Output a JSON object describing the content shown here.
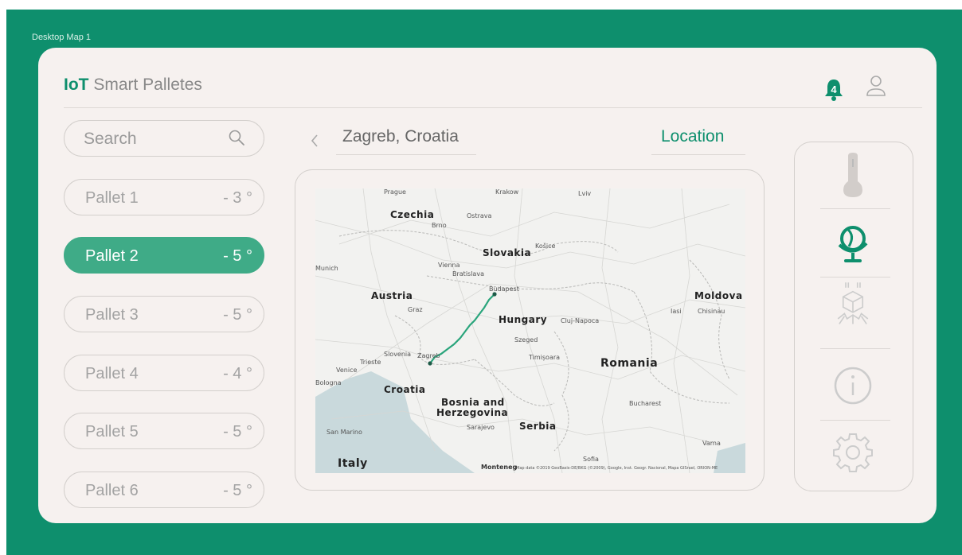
{
  "frame": {
    "label": "Desktop Map 1"
  },
  "header": {
    "brand_bold": "IoT",
    "brand_rest": " Smart Palletes",
    "notification_count": "4"
  },
  "search": {
    "placeholder": "Search"
  },
  "pallets": [
    {
      "name": "Pallet 1",
      "temp": "- 3 °",
      "active": false
    },
    {
      "name": "Pallet 2",
      "temp": "- 5 °",
      "active": true
    },
    {
      "name": "Pallet 3",
      "temp": "- 5 °",
      "active": false
    },
    {
      "name": "Pallet 4",
      "temp": "- 4 °",
      "active": false
    },
    {
      "name": "Pallet 5",
      "temp": "- 5 °",
      "active": false
    },
    {
      "name": "Pallet 6",
      "temp": "- 5 °",
      "active": false
    }
  ],
  "location_bar": {
    "back_icon": "chevron-left-icon",
    "city": "Zagreb, Croatia",
    "tab_label": "Location"
  },
  "map": {
    "labels": {
      "czechia": "Czechia",
      "slovakia": "Slovakia",
      "austria": "Austria",
      "hungary": "Hungary",
      "croatia": "Croatia",
      "bosnia": "Bosnia and",
      "bosnia2": "Herzegovina",
      "serbia": "Serbia",
      "romania": "Romania",
      "italy": "Italy",
      "moldova": "Moldova",
      "slovenia": "Slovenia",
      "budapest": "Budapest",
      "vienna": "Vienna",
      "bratislava": "Bratislava",
      "zagreb": "Zagreb",
      "prague": "Prague",
      "krakow": "Krakow",
      "brno": "Brno",
      "ostrava": "Ostrava",
      "kosice": "Košice",
      "munich": "Munich",
      "graz": "Graz",
      "venice": "Venice",
      "bologna": "Bologna",
      "trieste": "Trieste",
      "cluj": "Cluj-Napoca",
      "timisoara": "Timișoara",
      "bucharest": "Bucharest",
      "sarajevo": "Sarajevo",
      "sofia": "Sofia",
      "varna": "Varna",
      "lviv": "Lviv",
      "chisinau": "Chisinau",
      "iasi": "Iasi",
      "szeged": "Szeged",
      "sanmarino": "San Marino",
      "montenegro": "Monteneg",
      "attribution": "Map data ©2019 GeoBasis-DE/BKG (©2009), Google, Inst. Geogr. Nacional, Mapa GISrael, ORION-ME"
    }
  },
  "side_menu": [
    {
      "icon": "thermometer-icon"
    },
    {
      "icon": "globe-icon"
    },
    {
      "icon": "box-impact-icon"
    },
    {
      "icon": "info-icon"
    },
    {
      "icon": "gear-icon"
    }
  ],
  "colors": {
    "accent": "#0e8f6d",
    "active_pill": "#3fab87",
    "card_bg": "#f6f1ef"
  }
}
